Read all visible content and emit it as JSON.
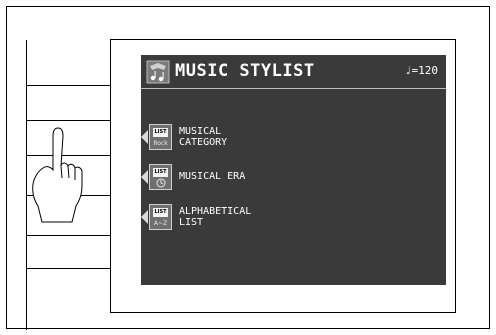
{
  "screen": {
    "title": "MUSIC STYLIST",
    "tempo": "♩=120"
  },
  "menu": [
    {
      "label_line1": "MUSICAL",
      "label_line2": "CATEGORY",
      "icon_badge": "LIST",
      "icon_sub": "Rock",
      "icon": "musical-category-icon"
    },
    {
      "label_line1": "MUSICAL ERA",
      "label_line2": "",
      "icon_badge": "LIST",
      "icon_sub": "",
      "icon": "musical-era-icon"
    },
    {
      "label_line1": "ALPHABETICAL",
      "label_line2": "LIST",
      "icon_badge": "LIST",
      "icon_sub": "A~Z",
      "icon": "alphabetical-list-icon"
    }
  ],
  "colors": {
    "screen_bg": "#3a3a3a",
    "text": "#ffffff",
    "icon_bg": "#6f6f6f"
  },
  "icons": [
    "music-stylist-icon",
    "pointing-hand-icon",
    "menu-arrow-icon"
  ]
}
